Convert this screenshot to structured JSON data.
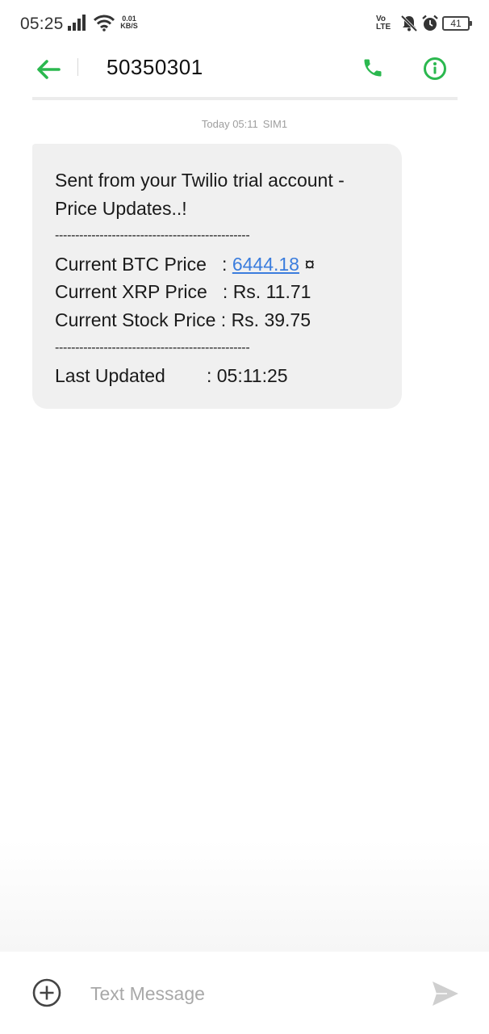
{
  "status_bar": {
    "time": "05:25",
    "net_speed_value": "0.01",
    "net_speed_unit": "KB/S",
    "volte_top": "Vo",
    "volte_bottom": "LTE",
    "battery": "41"
  },
  "header": {
    "contact": "50350301",
    "accent_color": "#2bb84f"
  },
  "conversation": {
    "timestamp": "Today 05:11",
    "sim": "SIM1",
    "message": {
      "line1": "Sent from your Twilio trial account -",
      "line2": "Price Updates..!",
      "separator": "------------------------------------------------",
      "btc_label": "Current BTC Price   : ",
      "btc_value": "6444.18",
      "btc_suffix": " ¤",
      "xrp": "Current XRP Price   : Rs. 11.71",
      "stock": "Current Stock Price : Rs. 39.75",
      "updated_label": "Last Updated        ",
      "updated_value": ": 05:11:25"
    }
  },
  "composer": {
    "placeholder": "Text Message"
  },
  "icons": {
    "back": "arrow-left-icon",
    "call": "phone-icon",
    "info": "info-icon",
    "add": "plus-circle-icon",
    "send": "send-icon"
  }
}
